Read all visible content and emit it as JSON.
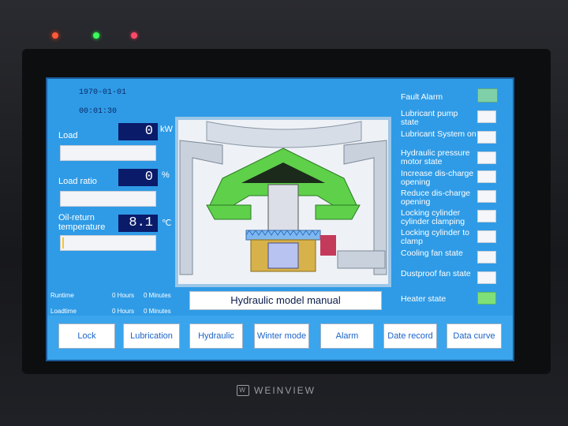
{
  "device": {
    "brand": "WEINVIEW"
  },
  "screen": {
    "date": "1970-01-01",
    "time": "00:01:30",
    "load": {
      "label": "Load",
      "value": "0",
      "unit": "kW",
      "level": 0
    },
    "load_ratio": {
      "label": "Load ratio",
      "value": "0",
      "unit": "%",
      "level": 0
    },
    "oil_return": {
      "label": "Oil-return\ntemperature",
      "value": "8.1",
      "unit": "℃",
      "level": 0.05
    },
    "runtime": {
      "label": "Runtime",
      "hours": "0 Hours",
      "minutes": "0 Minutes"
    },
    "loadtime": {
      "label": "Loadtime",
      "hours": "0 Hours",
      "minutes": "0 Minutes"
    },
    "mode_banner": "Hydraulic model manual",
    "status": [
      {
        "name": "fault-alarm",
        "label": "Fault Alarm",
        "state": "on"
      },
      {
        "name": "lubricant-pump-state",
        "label": "Lubricant pump state",
        "state": "off"
      },
      {
        "name": "lubricant-system-on",
        "label": "Lubricant System on",
        "state": "off"
      },
      {
        "name": "hydraulic-pressure-motor-state",
        "label": "Hydraulic pressure motor state",
        "state": "off"
      },
      {
        "name": "increase-discharge-opening",
        "label": "Increase dis-charge opening",
        "state": "off"
      },
      {
        "name": "reduce-discharge-opening",
        "label": "Reduce dis-charge opening",
        "state": "off"
      },
      {
        "name": "locking-cylinder-clamping",
        "label": "Locking cylinder cylinder clamping",
        "state": "off"
      },
      {
        "name": "locking-cylinder-to-clamp",
        "label": "Locking cylinder to clamp",
        "state": "off"
      },
      {
        "name": "cooling-fan-state",
        "label": "Cooling fan state",
        "state": "off"
      },
      {
        "name": "dustproof-fan-state",
        "label": "Dustproof fan state",
        "state": "off"
      },
      {
        "name": "heater-state",
        "label": "Heater state",
        "state": "on"
      }
    ],
    "nav": [
      "Lock",
      "Lubrication",
      "Hydraulic",
      "Winter mode",
      "Alarm",
      "Date record",
      "Data curve"
    ]
  },
  "colors": {
    "screen_bg": "#2f9be6",
    "value_box": "#0a1b6a",
    "fault_on": "#7fd0a8",
    "heater_on": "#7fe07a"
  }
}
